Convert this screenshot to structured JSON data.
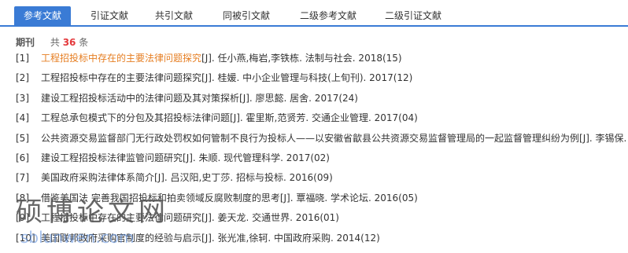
{
  "tabs": [
    {
      "label": "参考文献",
      "active": true
    },
    {
      "label": "引证文献",
      "active": false
    },
    {
      "label": "共引文献",
      "active": false
    },
    {
      "label": "同被引文献",
      "active": false
    },
    {
      "label": "二级参考文献",
      "active": false
    },
    {
      "label": "二级引证文献",
      "active": false
    }
  ],
  "count": {
    "label": "期刊",
    "prefix": "共",
    "number": "36",
    "suffix": "条"
  },
  "colors": {
    "accent": "#3a7bd5",
    "highlight": "#e67e22",
    "count": "#e4393c"
  },
  "references": [
    {
      "index": "[1]",
      "title": "工程招投标中存在的主要法律问题探究",
      "meta": "[J]. 任小燕,梅岩,李铁栋.  法制与社会. 2018(15)",
      "highlighted": true
    },
    {
      "index": "[2]",
      "title": "工程招投标中存在的主要法律问题探究",
      "meta": "[J]. 桂媛.  中小企业管理与科技(上旬刊). 2017(12)"
    },
    {
      "index": "[3]",
      "title": "建设工程招投标活动中的法律问题及其对策探析",
      "meta": "[J]. 廖思懿.  居舍. 2017(24)"
    },
    {
      "index": "[4]",
      "title": "工程总承包模式下的分包及其招投标法律问题",
      "meta": "[J]. 霍里斯,范贤芳.  交通企业管理. 2017(04)"
    },
    {
      "index": "[5]",
      "title": "公共资源交易监督部门无行政处罚权如何管制不良行为投标人——以安徽省歙县公共资源交易监督管理局的一起监督管理纠纷为例",
      "meta": "[J]. 李锡保."
    },
    {
      "index": "[6]",
      "title": "建设工程招投标法律监管问题研究",
      "meta": "[J]. 朱顺.  现代管理科学. 2017(02)"
    },
    {
      "index": "[7]",
      "title": "美国政府采购法律体系简介",
      "meta": "[J]. 吕汉阳,史丁莎.  招标与投标. 2016(09)"
    },
    {
      "index": "[8]",
      "title": "借鉴美国法 完善我国招投标和拍卖领域反腐败制度的思考",
      "meta": "[J]. 覃福晓.  学术论坛. 2016(05)"
    },
    {
      "index": "[9]",
      "title": "工程招投标中存在的主要法律问题研究",
      "meta": "[J]. 姜天龙.  交通世界. 2016(01)"
    },
    {
      "index": "[10]",
      "title": "美国联邦政府采购官制度的经验与启示",
      "meta": "[J]. 张光准,徐轲.  中国政府采购. 2014(12)"
    }
  ],
  "watermark": {
    "main": "硕博论文网",
    "url": "sblunwen.com"
  }
}
